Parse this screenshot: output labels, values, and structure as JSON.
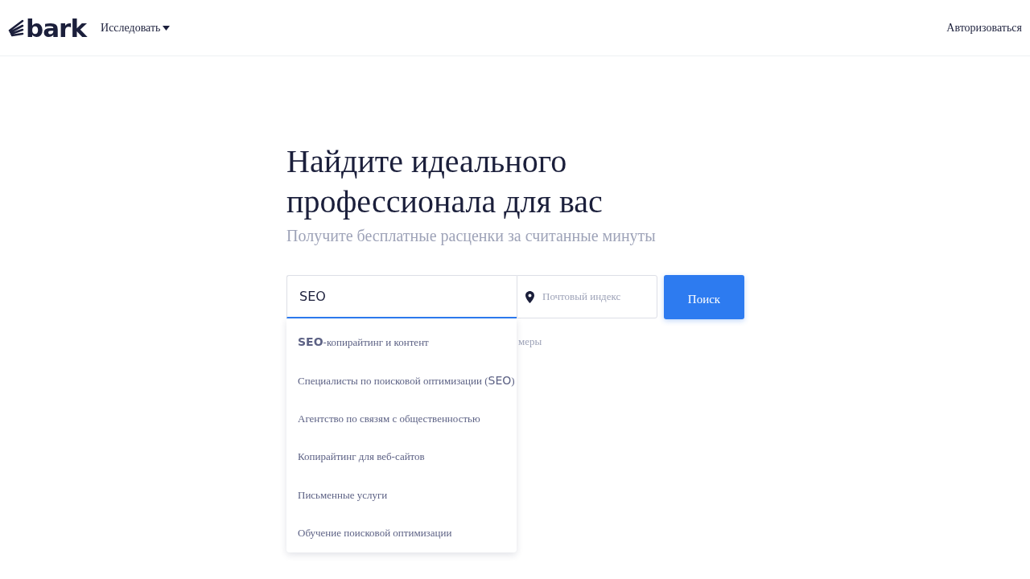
{
  "header": {
    "logo": "bark",
    "nav": [
      {
        "label": "Исследовать",
        "kind": "dropdown"
      }
    ],
    "login": "Авторизоваться"
  },
  "hero": {
    "title": "Найдите идеального профессионала для вас",
    "subtitle": "Получите бесплатные расценки за считанные минуты"
  },
  "search": {
    "service_value": "SEO",
    "postcode_placeholder": "Почтовый индекс",
    "button": "Поиск",
    "hint_visible": "меры"
  },
  "suggestions": [
    {
      "label": "**SEO**-копирайтинг и контент"
    },
    {
      "label": "Специалисты по поисковой оптимизации (**SEO**)"
    },
    {
      "label": "Агентство по связям с общественностью"
    },
    {
      "label": "Копирайтинг для веб-сайтов"
    },
    {
      "label": "Письменные услуги"
    },
    {
      "label": "Обучение поисковой оптимизации"
    }
  ]
}
